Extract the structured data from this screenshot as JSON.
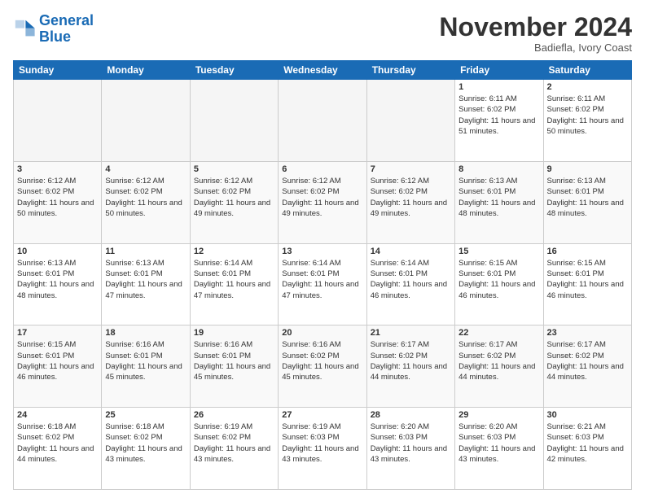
{
  "logo": {
    "line1": "General",
    "line2": "Blue"
  },
  "title": "November 2024",
  "location": "Badiefla, Ivory Coast",
  "days_of_week": [
    "Sunday",
    "Monday",
    "Tuesday",
    "Wednesday",
    "Thursday",
    "Friday",
    "Saturday"
  ],
  "weeks": [
    [
      {
        "num": "",
        "empty": true
      },
      {
        "num": "",
        "empty": true
      },
      {
        "num": "",
        "empty": true
      },
      {
        "num": "",
        "empty": true
      },
      {
        "num": "",
        "empty": true
      },
      {
        "num": "1",
        "detail": "Sunrise: 6:11 AM\nSunset: 6:02 PM\nDaylight: 11 hours\nand 51 minutes."
      },
      {
        "num": "2",
        "detail": "Sunrise: 6:11 AM\nSunset: 6:02 PM\nDaylight: 11 hours\nand 50 minutes."
      }
    ],
    [
      {
        "num": "3",
        "detail": "Sunrise: 6:12 AM\nSunset: 6:02 PM\nDaylight: 11 hours\nand 50 minutes."
      },
      {
        "num": "4",
        "detail": "Sunrise: 6:12 AM\nSunset: 6:02 PM\nDaylight: 11 hours\nand 50 minutes."
      },
      {
        "num": "5",
        "detail": "Sunrise: 6:12 AM\nSunset: 6:02 PM\nDaylight: 11 hours\nand 49 minutes."
      },
      {
        "num": "6",
        "detail": "Sunrise: 6:12 AM\nSunset: 6:02 PM\nDaylight: 11 hours\nand 49 minutes."
      },
      {
        "num": "7",
        "detail": "Sunrise: 6:12 AM\nSunset: 6:02 PM\nDaylight: 11 hours\nand 49 minutes."
      },
      {
        "num": "8",
        "detail": "Sunrise: 6:13 AM\nSunset: 6:01 PM\nDaylight: 11 hours\nand 48 minutes."
      },
      {
        "num": "9",
        "detail": "Sunrise: 6:13 AM\nSunset: 6:01 PM\nDaylight: 11 hours\nand 48 minutes."
      }
    ],
    [
      {
        "num": "10",
        "detail": "Sunrise: 6:13 AM\nSunset: 6:01 PM\nDaylight: 11 hours\nand 48 minutes."
      },
      {
        "num": "11",
        "detail": "Sunrise: 6:13 AM\nSunset: 6:01 PM\nDaylight: 11 hours\nand 47 minutes."
      },
      {
        "num": "12",
        "detail": "Sunrise: 6:14 AM\nSunset: 6:01 PM\nDaylight: 11 hours\nand 47 minutes."
      },
      {
        "num": "13",
        "detail": "Sunrise: 6:14 AM\nSunset: 6:01 PM\nDaylight: 11 hours\nand 47 minutes."
      },
      {
        "num": "14",
        "detail": "Sunrise: 6:14 AM\nSunset: 6:01 PM\nDaylight: 11 hours\nand 46 minutes."
      },
      {
        "num": "15",
        "detail": "Sunrise: 6:15 AM\nSunset: 6:01 PM\nDaylight: 11 hours\nand 46 minutes."
      },
      {
        "num": "16",
        "detail": "Sunrise: 6:15 AM\nSunset: 6:01 PM\nDaylight: 11 hours\nand 46 minutes."
      }
    ],
    [
      {
        "num": "17",
        "detail": "Sunrise: 6:15 AM\nSunset: 6:01 PM\nDaylight: 11 hours\nand 46 minutes."
      },
      {
        "num": "18",
        "detail": "Sunrise: 6:16 AM\nSunset: 6:01 PM\nDaylight: 11 hours\nand 45 minutes."
      },
      {
        "num": "19",
        "detail": "Sunrise: 6:16 AM\nSunset: 6:01 PM\nDaylight: 11 hours\nand 45 minutes."
      },
      {
        "num": "20",
        "detail": "Sunrise: 6:16 AM\nSunset: 6:02 PM\nDaylight: 11 hours\nand 45 minutes."
      },
      {
        "num": "21",
        "detail": "Sunrise: 6:17 AM\nSunset: 6:02 PM\nDaylight: 11 hours\nand 44 minutes."
      },
      {
        "num": "22",
        "detail": "Sunrise: 6:17 AM\nSunset: 6:02 PM\nDaylight: 11 hours\nand 44 minutes."
      },
      {
        "num": "23",
        "detail": "Sunrise: 6:17 AM\nSunset: 6:02 PM\nDaylight: 11 hours\nand 44 minutes."
      }
    ],
    [
      {
        "num": "24",
        "detail": "Sunrise: 6:18 AM\nSunset: 6:02 PM\nDaylight: 11 hours\nand 44 minutes."
      },
      {
        "num": "25",
        "detail": "Sunrise: 6:18 AM\nSunset: 6:02 PM\nDaylight: 11 hours\nand 43 minutes."
      },
      {
        "num": "26",
        "detail": "Sunrise: 6:19 AM\nSunset: 6:02 PM\nDaylight: 11 hours\nand 43 minutes."
      },
      {
        "num": "27",
        "detail": "Sunrise: 6:19 AM\nSunset: 6:03 PM\nDaylight: 11 hours\nand 43 minutes."
      },
      {
        "num": "28",
        "detail": "Sunrise: 6:20 AM\nSunset: 6:03 PM\nDaylight: 11 hours\nand 43 minutes."
      },
      {
        "num": "29",
        "detail": "Sunrise: 6:20 AM\nSunset: 6:03 PM\nDaylight: 11 hours\nand 43 minutes."
      },
      {
        "num": "30",
        "detail": "Sunrise: 6:21 AM\nSunset: 6:03 PM\nDaylight: 11 hours\nand 42 minutes."
      }
    ]
  ]
}
